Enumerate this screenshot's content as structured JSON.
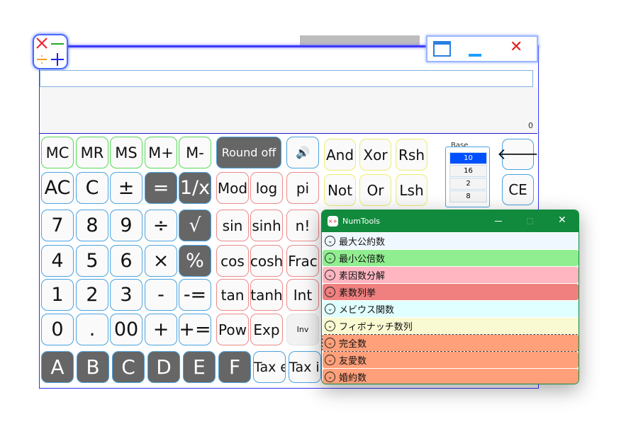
{
  "display": {
    "value": "0"
  },
  "window_controls": {
    "restore": "restore-icon",
    "minimize": "minimize-icon",
    "close": "close-icon"
  },
  "keypad": {
    "memory": [
      "MC",
      "MR",
      "MS",
      "M+",
      "M-"
    ],
    "rows": [
      [
        "AC",
        "C",
        "±",
        "=",
        "1/x"
      ],
      [
        "7",
        "8",
        "9",
        "÷",
        "√"
      ],
      [
        "4",
        "5",
        "6",
        "×",
        "%"
      ],
      [
        "1",
        "2",
        "3",
        "-",
        "-="
      ],
      [
        "0",
        ".",
        "00",
        "+",
        "+="
      ]
    ],
    "round_off": "Round off",
    "speaker_icon": "speaker-icon",
    "func_rows": [
      [
        "Mod",
        "log",
        "pi"
      ],
      [
        "sin",
        "sinh",
        "n!"
      ],
      [
        "cos",
        "cosh",
        "Frac"
      ],
      [
        "tan",
        "tanh",
        "Int"
      ],
      [
        "Pow",
        "Exp",
        "Inv"
      ]
    ],
    "logic_rows": [
      [
        "And",
        "Xor",
        "Rsh"
      ],
      [
        "Not",
        "Or",
        "Lsh"
      ]
    ],
    "hex": [
      "A",
      "B",
      "C",
      "D",
      "E",
      "F"
    ],
    "tax": [
      "Tax e",
      "Tax i"
    ],
    "backspace": "🡐",
    "ce": "CE"
  },
  "base": {
    "label": "Base",
    "options": [
      "10",
      "16",
      "2",
      "8"
    ],
    "selected": "10"
  },
  "numtools": {
    "title": "NumTools",
    "items": [
      {
        "label": "最大公約数",
        "color": "#f0f8ff"
      },
      {
        "label": "最小公倍数",
        "color": "#90ee90"
      },
      {
        "label": "素因数分解",
        "color": "#ffb6c1"
      },
      {
        "label": "素数列挙",
        "color": "#f08080"
      },
      {
        "label": "メビウス関数",
        "color": "#e0ffff"
      },
      {
        "label": "フィボナッチ数列",
        "color": "#fafad2"
      },
      {
        "label": "完全数",
        "color": "#ffa07a"
      },
      {
        "label": "友愛数",
        "color": "#ffa07a"
      },
      {
        "label": "婚約数",
        "color": "#ffa07a"
      }
    ]
  }
}
